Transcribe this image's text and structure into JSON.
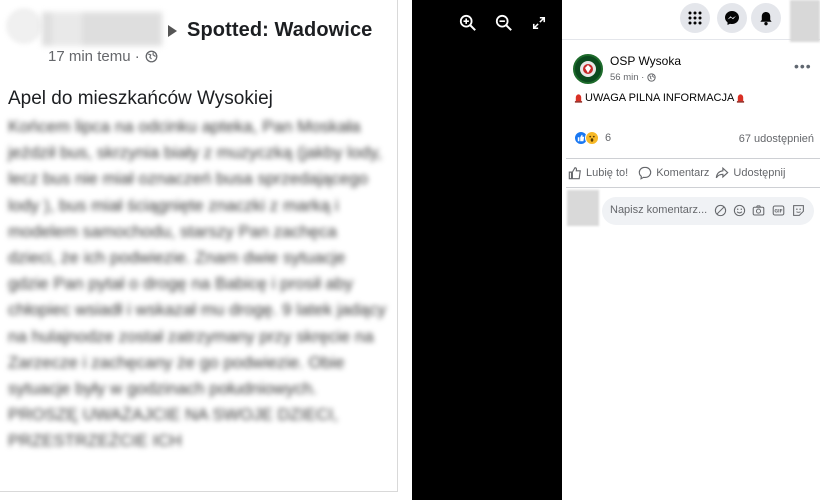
{
  "screenshot": {
    "group_name": "Spotted: Wadowice",
    "post_time": "17 min temu ·",
    "post_title": "Apel do mieszkańców Wysokiej",
    "post_body": "Końcem lipca na odcinku apteka, Pan Moskała jeździł bus, skrzynia biały z muzyczką (jakby lody, lecz bus nie miał oznaczeń busa sprzedającego lody ), bus miał ściągnięte znaczki z marką i modelem samochodu, starszy Pan zachęca dzieci, że ich podwiezie. Znam dwie sytuacje gdzie Pan pytał o drogę na Babicę i prosił aby chłopiec wsiadł i wskazał mu drogę. 9 latek jadący na hulajnodze został zatrzymany przy skręcie na Zarzecze i zachęcany że go podwiezie. Obie sytuacje były w godzinach południowych. PROSZĘ UWAŻAJCIE NA SWOJE DZIECI, PRZESTRZEŻCIE ICH"
  },
  "viewer": {
    "icons": [
      "zoom-in-icon",
      "zoom-out-icon",
      "fullscreen-icon"
    ]
  },
  "topbar": {
    "icons": [
      "menu-grid-icon",
      "messenger-icon",
      "notifications-bell-icon"
    ]
  },
  "post": {
    "page_name": "OSP Wysoka",
    "time": "56 min ·",
    "text": "UWAGA PILNA INFORMACJA",
    "reaction_count": "6",
    "shares": "67 udostępnień",
    "like_label": "Lubię to!",
    "comment_label": "Komentarz",
    "share_label": "Udostępnij"
  },
  "comment": {
    "placeholder": "Napisz komentarz..."
  },
  "colors": {
    "accent": "#1877f2",
    "viewer_bg": "#000000",
    "siren": "#d93025",
    "muted": "#65676b"
  }
}
